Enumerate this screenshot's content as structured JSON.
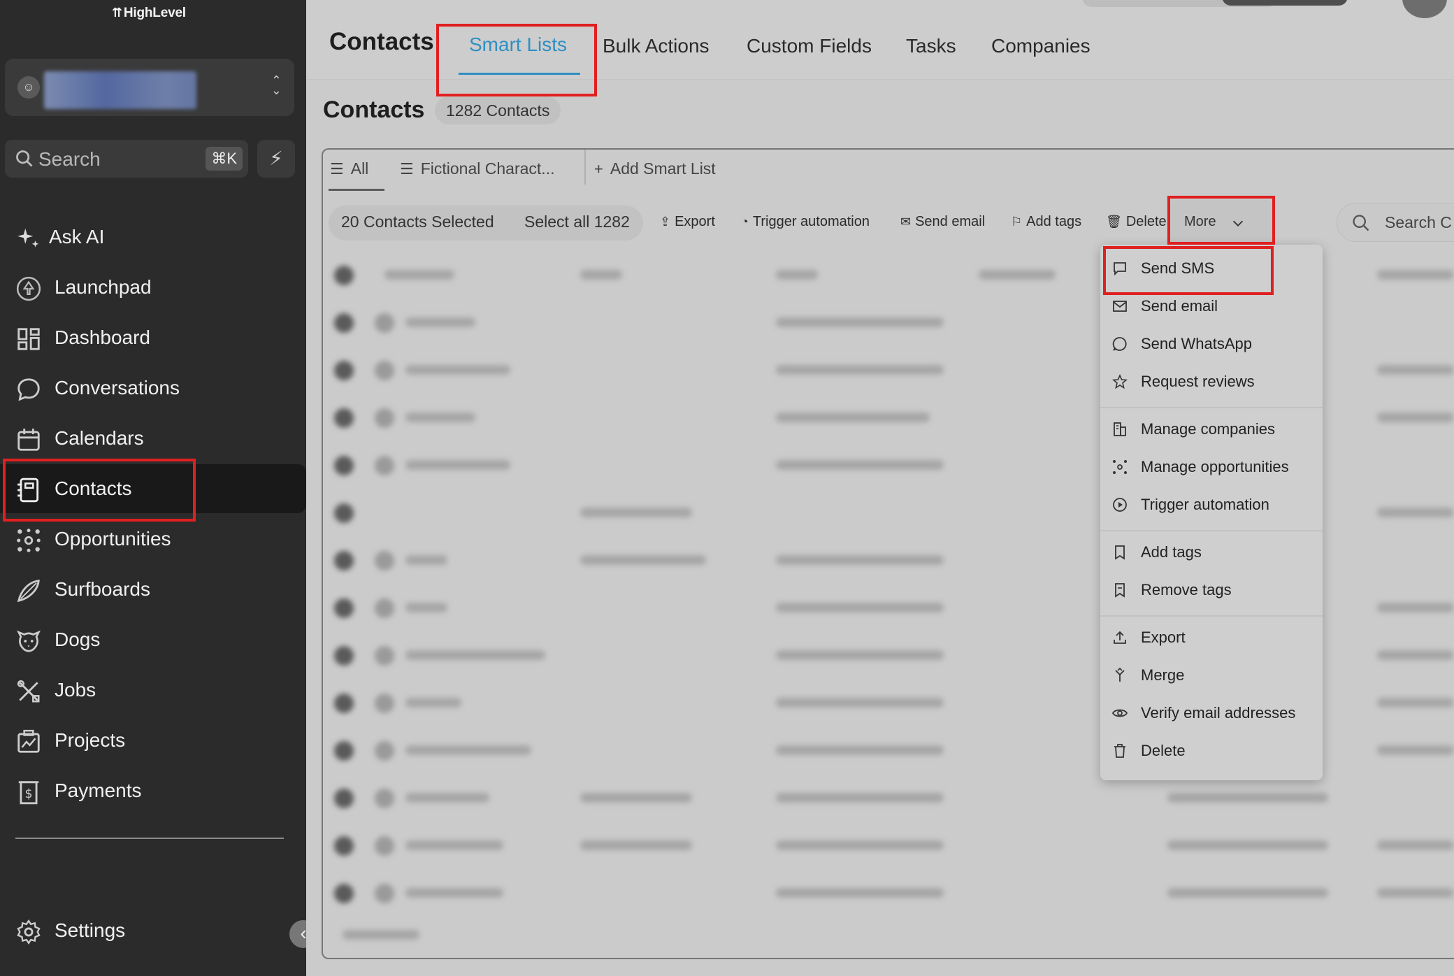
{
  "brand": {
    "logo": "HighLevel"
  },
  "sidebar": {
    "search": {
      "placeholder": "Search",
      "shortcut": "⌘K"
    },
    "items": [
      {
        "label": "Ask AI",
        "icon": "sparkle-icon"
      },
      {
        "label": "Launchpad",
        "icon": "rocket-icon"
      },
      {
        "label": "Dashboard",
        "icon": "dashboard-icon"
      },
      {
        "label": "Conversations",
        "icon": "chat-bubble-icon"
      },
      {
        "label": "Calendars",
        "icon": "calendar-icon"
      },
      {
        "label": "Contacts",
        "icon": "contacts-book-icon",
        "active": true
      },
      {
        "label": "Opportunities",
        "icon": "opportunities-icon"
      },
      {
        "label": "Surfboards",
        "icon": "surfboard-icon"
      },
      {
        "label": "Dogs",
        "icon": "dog-icon"
      },
      {
        "label": "Jobs",
        "icon": "tools-icon"
      },
      {
        "label": "Projects",
        "icon": "projects-icon"
      },
      {
        "label": "Payments",
        "icon": "payments-icon"
      }
    ],
    "settings": {
      "label": "Settings",
      "icon": "gear-icon"
    }
  },
  "header": {
    "title": "Contacts",
    "tabs": [
      {
        "label": "Smart Lists",
        "active": true
      },
      {
        "label": "Bulk Actions"
      },
      {
        "label": "Custom Fields"
      },
      {
        "label": "Tasks"
      },
      {
        "label": "Companies"
      }
    ]
  },
  "page": {
    "title": "Contacts",
    "count": "1282 Contacts"
  },
  "lists": {
    "tabs": [
      {
        "label": "All",
        "active": true
      },
      {
        "label": "Fictional Charact..."
      }
    ],
    "add_label": "Add Smart List"
  },
  "toolbar": {
    "selected": "20 Contacts Selected",
    "select_all": "Select all 1282",
    "actions": [
      {
        "label": "Export",
        "icon": "upload-icon"
      },
      {
        "label": "Trigger automation",
        "icon": "automation-icon"
      },
      {
        "label": "Send email",
        "icon": "mail-icon"
      },
      {
        "label": "Add tags",
        "icon": "tag-icon"
      },
      {
        "label": "Delete",
        "icon": "trash-icon"
      }
    ],
    "more_label": "More",
    "search_placeholder": "Search C"
  },
  "dropdown": {
    "items": [
      {
        "label": "Send SMS",
        "icon": "sms-icon"
      },
      {
        "label": "Send email",
        "icon": "mail-icon"
      },
      {
        "label": "Send WhatsApp",
        "icon": "whatsapp-icon"
      },
      {
        "label": "Request reviews",
        "icon": "star-icon"
      },
      {
        "label": "Manage companies",
        "icon": "building-icon"
      },
      {
        "label": "Manage opportunities",
        "icon": "opportunities-icon"
      },
      {
        "label": "Trigger automation",
        "icon": "automation-icon"
      },
      {
        "label": "Add tags",
        "icon": "tag-icon"
      },
      {
        "label": "Remove tags",
        "icon": "tag-remove-icon"
      },
      {
        "label": "Export",
        "icon": "upload-icon"
      },
      {
        "label": "Merge",
        "icon": "merge-icon"
      },
      {
        "label": "Verify email addresses",
        "icon": "eye-icon"
      },
      {
        "label": "Delete",
        "icon": "trash-icon"
      }
    ]
  },
  "colors": {
    "accent": "#2f8fc3",
    "highlight": "#e02020",
    "sidebar_bg": "#2b2b2b"
  }
}
